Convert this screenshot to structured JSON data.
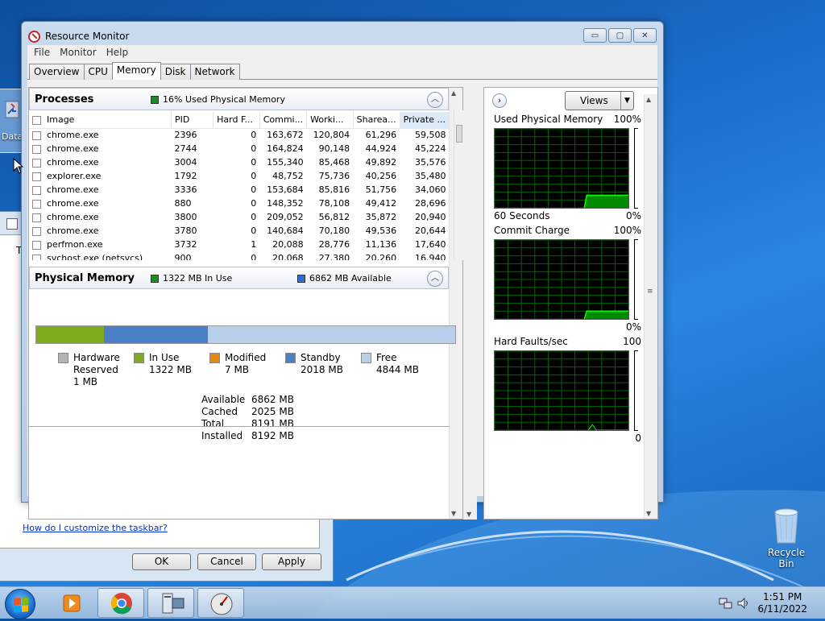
{
  "desktop": {
    "partial_icon_label": "Data",
    "recycle_bin_label": "Recycle Bin"
  },
  "back_dialog": {
    "link_text": "How do I customize the taskbar?",
    "ok_label": "OK",
    "cancel_label": "Cancel",
    "apply_label": "Apply",
    "partial_char": "T"
  },
  "window": {
    "title": "Resource Monitor",
    "controls": {
      "minimize": "▭",
      "maximize": "▢",
      "close": "✕"
    },
    "menu": [
      "File",
      "Monitor",
      "Help"
    ],
    "tabs": [
      "Overview",
      "CPU",
      "Memory",
      "Disk",
      "Network"
    ],
    "active_tab": "Memory"
  },
  "processes": {
    "title": "Processes",
    "status": "16% Used Physical Memory",
    "columns": [
      "Image",
      "PID",
      "Hard F...",
      "Commi...",
      "Worki...",
      "Sharea...",
      "Private ..."
    ],
    "rows": [
      [
        "chrome.exe",
        "2396",
        "0",
        "163,672",
        "120,804",
        "61,296",
        "59,508"
      ],
      [
        "chrome.exe",
        "2744",
        "0",
        "164,824",
        "90,148",
        "44,924",
        "45,224"
      ],
      [
        "chrome.exe",
        "3004",
        "0",
        "155,340",
        "85,468",
        "49,892",
        "35,576"
      ],
      [
        "explorer.exe",
        "1792",
        "0",
        "48,752",
        "75,736",
        "40,256",
        "35,480"
      ],
      [
        "chrome.exe",
        "3336",
        "0",
        "153,684",
        "85,816",
        "51,756",
        "34,060"
      ],
      [
        "chrome.exe",
        "880",
        "0",
        "148,352",
        "78,108",
        "49,412",
        "28,696"
      ],
      [
        "chrome.exe",
        "3800",
        "0",
        "209,052",
        "56,812",
        "35,872",
        "20,940"
      ],
      [
        "chrome.exe",
        "3780",
        "0",
        "140,684",
        "70,180",
        "49,536",
        "20,644"
      ],
      [
        "perfmon.exe",
        "3732",
        "1",
        "20,088",
        "28,776",
        "11,136",
        "17,640"
      ],
      [
        "svchost.exe (netsvcs)",
        "900",
        "0",
        "20,068",
        "27,380",
        "20,260",
        "16,940"
      ]
    ]
  },
  "physical_memory": {
    "title": "Physical Memory",
    "in_use_status": "1322 MB In Use",
    "available_status": "6862 MB Available",
    "breakdown_mb": {
      "hardware_reserved": 1,
      "in_use": 1322,
      "modified": 7,
      "standby": 2018,
      "free": 4844
    },
    "legend": [
      {
        "key": "hardware_reserved",
        "label": "Hardware Reserved",
        "value": "1 MB",
        "color": "#b4b4b4"
      },
      {
        "key": "in_use",
        "label": "In Use",
        "value": "1322 MB",
        "color": "#7fab1f"
      },
      {
        "key": "modified",
        "label": "Modified",
        "value": "7 MB",
        "color": "#e8860e"
      },
      {
        "key": "standby",
        "label": "Standby",
        "value": "2018 MB",
        "color": "#4b7fc6"
      },
      {
        "key": "free",
        "label": "Free",
        "value": "4844 MB",
        "color": "#b8d0ea"
      }
    ],
    "totals": [
      {
        "label": "Available",
        "value": "6862 MB"
      },
      {
        "label": "Cached",
        "value": "2025 MB"
      },
      {
        "label": "Total",
        "value": "8191 MB"
      },
      {
        "label": "Installed",
        "value": "8192 MB"
      }
    ]
  },
  "graphs_pane": {
    "views_label": "Views",
    "graphs": [
      {
        "title": "Used Physical Memory",
        "max_label": "100%",
        "min_label": "0%",
        "time_label": "60 Seconds",
        "level": 0.16
      },
      {
        "title": "Commit Charge",
        "max_label": "100%",
        "min_label": "0%",
        "time_label": "",
        "level": 0.1
      },
      {
        "title": "Hard Faults/sec",
        "max_label": "100",
        "min_label": "0",
        "time_label": "",
        "level": 0.0
      }
    ]
  },
  "taskbar": {
    "time": "1:51 PM",
    "date": "6/11/2022"
  },
  "colors": {
    "accent": "#3399ff",
    "graph_line": "#00ff00",
    "graph_fill": "#008a00",
    "graph_grid": "#006400"
  }
}
